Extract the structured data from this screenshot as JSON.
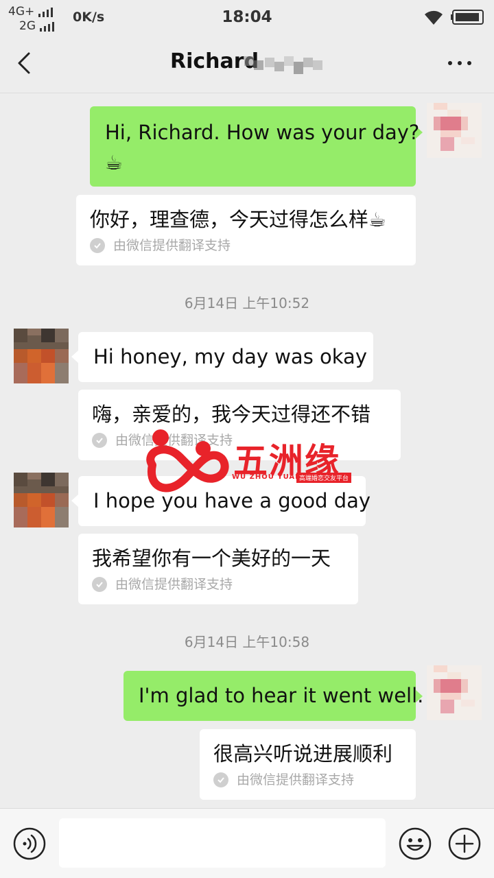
{
  "status_bar": {
    "network_top": "4G+",
    "network_bottom": "2G",
    "speed": "0K/s",
    "time": "18:04"
  },
  "header": {
    "contact_name": "Richard"
  },
  "messages": [
    {
      "side": "out",
      "text": "Hi, Richard. How was your day?",
      "emoji": "☕",
      "translation": "你好，理查德，今天过得怎么样☕",
      "translation_note": "由微信提供翻译支持"
    },
    {
      "timestamp": "6月14日 上午10:52"
    },
    {
      "side": "in",
      "text": "Hi honey,  my day was okay",
      "translation": "嗨，亲爱的，我今天过得还不错",
      "translation_note": "由微信提供翻译支持"
    },
    {
      "side": "in",
      "text": "I hope you have a good day",
      "translation": "我希望你有一个美好的一天",
      "translation_note": "由微信提供翻译支持"
    },
    {
      "timestamp": "6月14日 上午10:58"
    },
    {
      "side": "out",
      "text": "I'm glad to hear it went well.",
      "translation": "很高兴听说进展顺利",
      "translation_note": "由微信提供翻译支持"
    }
  ],
  "watermark": {
    "name": "五洲缘",
    "pinyin": "WU ZHOU YUAN",
    "tagline": "高端婚恋交友平台"
  },
  "colors": {
    "outgoing_bubble": "#95ec69",
    "incoming_bubble": "#ffffff",
    "background": "#ededed",
    "watermark_red": "#e8232a"
  },
  "icons": {
    "back": "chevron-left-icon",
    "more": "more-dots-icon",
    "voice": "voice-icon",
    "emoji": "emoji-icon",
    "add": "plus-icon",
    "wifi": "wifi-icon",
    "battery": "battery-icon",
    "translation_check": "check-icon"
  }
}
